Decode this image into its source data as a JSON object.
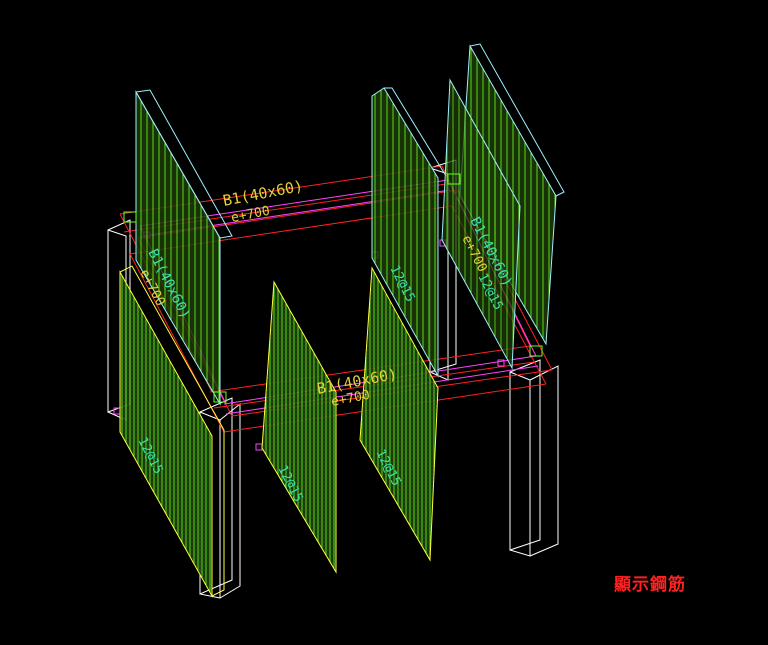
{
  "drawing": {
    "colors": {
      "background": "#000000",
      "wire": "#ffffff",
      "column": "#ffffff",
      "beam": "#ff2020",
      "beam_inner": "#ff44ff",
      "wall_outline": "#ffff40",
      "wall_outline_cyan": "#9ff0ff",
      "rebar": "#66ff22",
      "label": "#e6d03a",
      "label_cyan": "#39e0b0"
    },
    "beam_labels": [
      {
        "text": "B1(40x60)",
        "sub": "e+700"
      },
      {
        "text": "B1(40x60)",
        "sub": "e+700"
      },
      {
        "text": "B1(40x60)",
        "sub": "e+700"
      },
      {
        "text": "B1(40x60)",
        "sub": "e+700"
      }
    ],
    "wall_labels": [
      "12@15",
      "12@15",
      "12@15",
      "12@15",
      "12@15"
    ]
  },
  "status": {
    "text": "顯示鋼筋"
  }
}
